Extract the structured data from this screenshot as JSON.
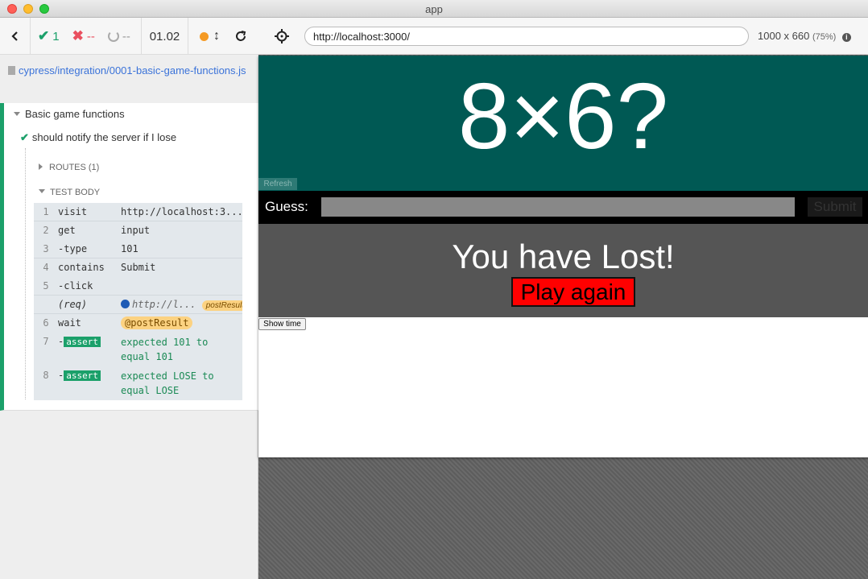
{
  "window": {
    "title": "app"
  },
  "reporter": {
    "stats": {
      "passed": "1",
      "failed": "--",
      "pending": "--",
      "duration": "01.02"
    },
    "spec_file": "cypress/integration/0001-basic-game-functions.js",
    "suite": "Basic game functions",
    "test": "should notify the server if I lose",
    "routes_label": "ROUTES (1)",
    "test_body_label": "TEST BODY",
    "commands": [
      {
        "num": "1",
        "name": "visit",
        "msg": "http://localhost:3..."
      },
      {
        "num": "2",
        "name": "get",
        "msg": "input"
      },
      {
        "num": "3",
        "name": "-type",
        "msg": "101"
      },
      {
        "num": "4",
        "name": "contains",
        "msg": "Submit"
      },
      {
        "num": "5",
        "name": "-click",
        "msg": ""
      },
      {
        "num": "",
        "name": "(req)",
        "msg": "http://l...",
        "alias": "postResult"
      },
      {
        "num": "6",
        "name": "wait",
        "msg": "@postResult"
      },
      {
        "num": "7",
        "name": "assert",
        "msg": "expected 101 to equal 101"
      },
      {
        "num": "8",
        "name": "assert",
        "msg": "expected LOSE to equal LOSE"
      }
    ]
  },
  "aut": {
    "url": "http://localhost:3000/",
    "viewport": "1000 x 660",
    "scale": "(75%)",
    "app": {
      "question": "8×6?",
      "refresh_label": "Refresh",
      "guess_label": "Guess:",
      "submit_label": "Submit",
      "result_text": "You have Lost!",
      "play_again_label": "Play again",
      "show_time_label": "Show time"
    }
  },
  "colors": {
    "pass": "#1ba06a",
    "fail": "#e94f5f",
    "question_bg": "#005954",
    "result_bg": "#555555",
    "play_again_bg": "#ff0000"
  }
}
